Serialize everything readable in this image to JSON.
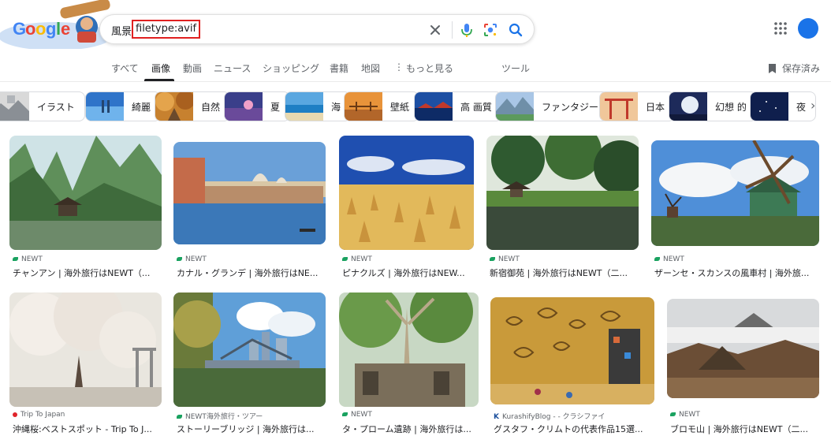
{
  "search": {
    "query_prefix": "風景",
    "query_filter": "filetype:avif"
  },
  "tabs": [
    "すべて",
    "画像",
    "動画",
    "ニュース",
    "ショッピング",
    "書籍",
    "地図",
    "もっと見る",
    "ツール"
  ],
  "active_tab": "画像",
  "saved_label": "保存済み",
  "chips": [
    "イラスト",
    "綺麗",
    "自然",
    "夏",
    "海",
    "壁紙",
    "高 画質",
    "ファンタジー",
    "日本",
    "幻想 的",
    "夜"
  ],
  "results": [
    {
      "source": "NEWT",
      "title": "チャンアン | 海外旅行はNEWT（..."
    },
    {
      "source": "NEWT",
      "title": "カナル・グランデ | 海外旅行はNE..."
    },
    {
      "source": "NEWT",
      "title": "ピナクルズ | 海外旅行はNEW..."
    },
    {
      "source": "NEWT",
      "title": "新宿御苑 | 海外旅行はNEWT（二..."
    },
    {
      "source": "NEWT",
      "title": "ザーンセ・スカンスの風車村 | 海外旅..."
    },
    {
      "source": "Trip To Japan",
      "title": "沖縄桜:ベストスポット - Trip To J..."
    },
    {
      "source": "NEWT海外旅行・ツアー",
      "title": "ストーリーブリッジ | 海外旅行は..."
    },
    {
      "source": "NEWT",
      "title": "タ・プローム遺跡 | 海外旅行は..."
    },
    {
      "source": "KurashifyBlog - - クラシファイ",
      "title": "グスタフ・クリムトの代表作品15選..."
    },
    {
      "source": "NEWT",
      "title": "ブロモ山 | 海外旅行はNEWT（二..."
    }
  ],
  "colors": {
    "accent": "#1a73e8",
    "highlight_border": "#e02020",
    "newt_green": "#1aa260"
  }
}
